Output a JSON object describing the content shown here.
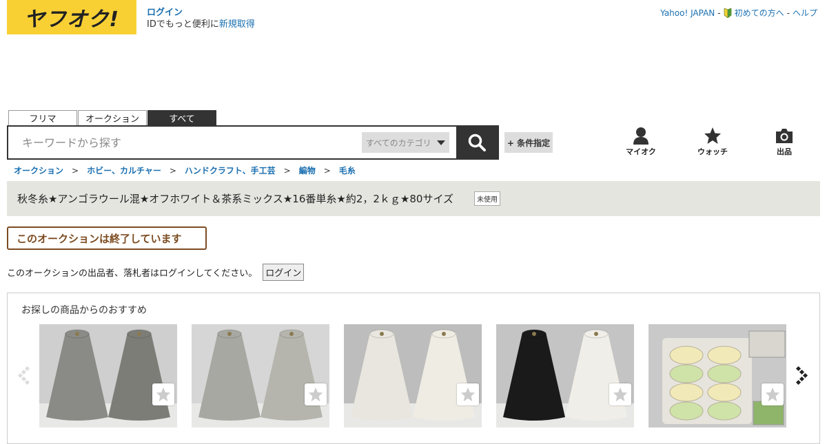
{
  "logo": {
    "text": "ヤフオク!"
  },
  "user": {
    "login_label": "ログイン",
    "subtext": "IDでもっと便利に",
    "register_label": "新規取得"
  },
  "top_links": {
    "yahoo": "Yahoo! JAPAN",
    "beginner": "初めての方へ",
    "help": "ヘルプ"
  },
  "search": {
    "tabs": [
      {
        "label": "フリマ",
        "active": false
      },
      {
        "label": "オークション",
        "active": false
      },
      {
        "label": "すべて",
        "active": true
      }
    ],
    "placeholder": "キーワードから探す",
    "category": "すべてのカテゴリ",
    "condition_label": "+ 条件指定"
  },
  "nav": {
    "myauc": "マイオク",
    "watch": "ウォッチ",
    "sell": "出品"
  },
  "breadcrumb": [
    "オークション",
    "ホビー、カルチャー",
    "ハンドクラフト、手工芸",
    "編物",
    "毛糸"
  ],
  "item": {
    "title": "秋冬糸★アンゴラウール混★オフホワイト＆茶系ミックス★16番単糸★約2，2ｋｇ★80サイズ",
    "condition_badge": "未使用",
    "ended_message": "このオークションは終了しています",
    "login_note": "このオークションの出品者、落札者はログインしてください。",
    "login_button": "ログイン"
  },
  "recommend": {
    "heading": "お探しの商品からのおすすめ",
    "items": [
      {
        "color_left": "#8a8a86",
        "color_right": "#7d7d78",
        "bg": "#cfcfcf"
      },
      {
        "color_left": "#a8a8a2",
        "color_right": "#b5b5ae",
        "bg": "#d6d6d6"
      },
      {
        "color_left": "#e8e6de",
        "color_right": "#efece4",
        "bg": "#bdbdbd"
      },
      {
        "color_left": "#1a1a1a",
        "color_right": "#f0eee8",
        "bg": "#c4c4c4"
      },
      {
        "color_left": "#ecebe6",
        "color_right": "#dcdad2",
        "bg": "#c9c9c9"
      }
    ]
  },
  "colors": {
    "accent_yellow": "#f8d034",
    "link_blue": "#1a6fb0",
    "ended_brown": "#7b4a20",
    "title_bg": "#e5e5e0"
  }
}
